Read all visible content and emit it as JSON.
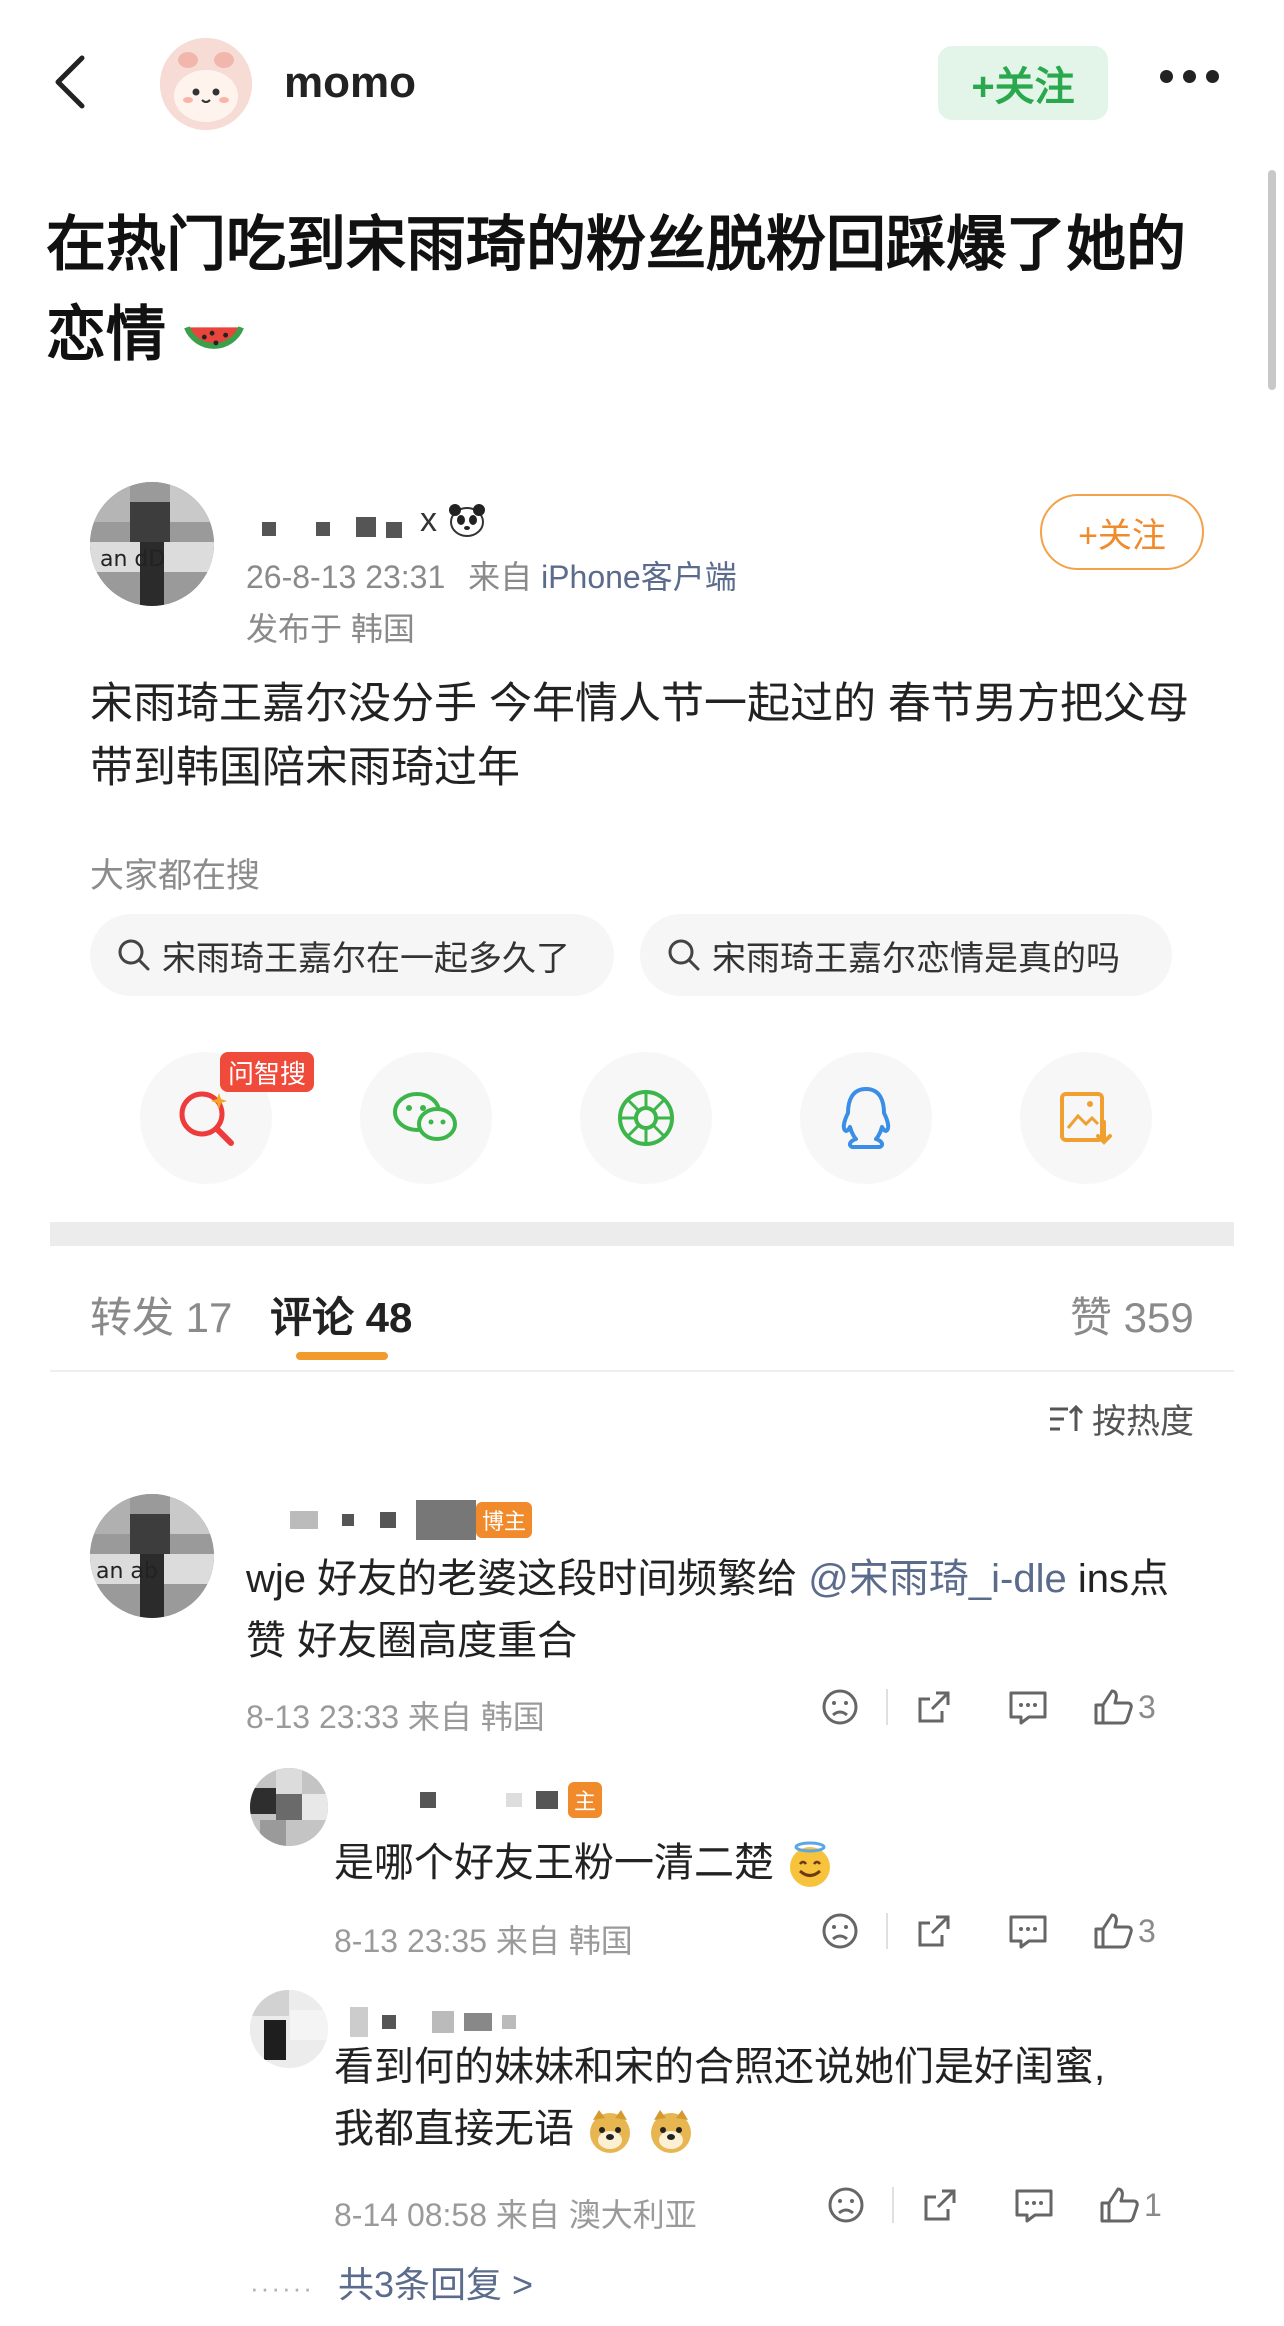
{
  "header": {
    "username": "momo",
    "follow_label": "+关注",
    "post_title": "在热门吃到宋雨琦的粉丝脱粉回踩爆了她的恋情"
  },
  "card": {
    "name_suffix": "x",
    "time": "26-8-13 23:31",
    "source_prefix": "来自",
    "source": "iPhone客户端",
    "location": "发布于 韩国",
    "follow_label": "+关注",
    "body": "宋雨琦王嘉尔没分手 今年情人节一起过的 春节男方把父母带到韩国陪宋雨琦过年",
    "search_label": "大家都在搜",
    "chips": [
      "宋雨琦王嘉尔在一起多久了",
      "宋雨琦王嘉尔恋情是真的吗"
    ],
    "share_tag": "问智搜"
  },
  "tabs": {
    "repost": "转发 17",
    "comment": "评论 48",
    "like": "赞 359"
  },
  "sort_label": "按热度",
  "comments": [
    {
      "badge": "博主",
      "text_prefix": "wje 好友的老婆这段时间频繁给",
      "mention": "@宋雨琦_i-dle",
      "text_suffix": "ins点赞  好友圈高度重合",
      "meta": "8-13 23:33  来自 韩国",
      "likes": "3"
    },
    {
      "badge": "主",
      "text": "是哪个好友王粉一清二楚",
      "meta": "8-13 23:35  来自 韩国",
      "likes": "3"
    },
    {
      "text_line1": "看到何的妹妹和宋的合照还说她们是好闺蜜,",
      "text_line2": "我都直接无语",
      "meta": "8-14 08:58  来自 澳大利亚",
      "likes": "1"
    }
  ],
  "more_replies": "共3条回复 >",
  "colors": {
    "follow_green": "#2aa84e",
    "follow_orange": "#f08a2a",
    "link_blue": "#5b6b8c",
    "tab_underline": "#f39a2e"
  }
}
